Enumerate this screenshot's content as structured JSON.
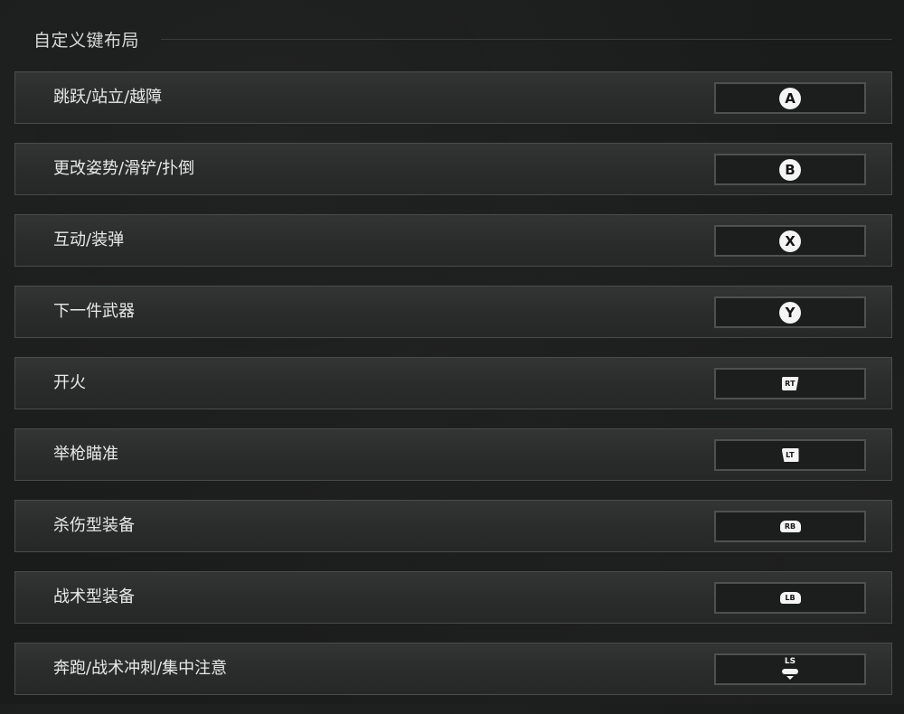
{
  "section": {
    "title": "自定义键布局"
  },
  "bindings": [
    {
      "action": "跳跃/站立/越障",
      "button": "A"
    },
    {
      "action": "更改姿势/滑铲/扑倒",
      "button": "B"
    },
    {
      "action": "互动/装弹",
      "button": "X"
    },
    {
      "action": "下一件武器",
      "button": "Y"
    },
    {
      "action": "开火",
      "button": "RT"
    },
    {
      "action": "举枪瞄准",
      "button": "LT"
    },
    {
      "action": "杀伤型装备",
      "button": "RB"
    },
    {
      "action": "战术型装备",
      "button": "LB"
    },
    {
      "action": "奔跑/战术冲刺/集中注意",
      "button": "LS"
    }
  ],
  "glyph_icons": {
    "A": "a-button-icon",
    "B": "b-button-icon",
    "X": "x-button-icon",
    "Y": "y-button-icon",
    "RT": "right-trigger-icon",
    "LT": "left-trigger-icon",
    "RB": "right-bumper-icon",
    "LB": "left-bumper-icon",
    "LS": "left-stick-click-icon"
  },
  "colors": {
    "background": "#1a1b1b",
    "row_fill": "#2e3030",
    "row_border": "#4a4c4c",
    "key_box_fill": "#1c1d1d",
    "glyph": "#f4f4f4",
    "text": "#e8e8e8"
  }
}
